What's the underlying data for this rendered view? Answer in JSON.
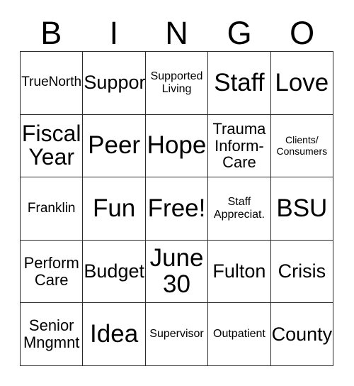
{
  "card": {
    "title": "BINGO",
    "header_letters": [
      "B",
      "I",
      "N",
      "G",
      "O"
    ],
    "border_color": "#2b2b2b",
    "cell_background": "#ffffff",
    "text_color": "#000000",
    "columns": 5,
    "rows": 5,
    "free_space_label": "Free!",
    "cells": [
      [
        {
          "text": "TrueNorth",
          "size": "sm"
        },
        {
          "text": "Support",
          "size": "lg"
        },
        {
          "text": "Supported\nLiving",
          "size": "xs"
        },
        {
          "text": "Staff",
          "size": "xxl"
        },
        {
          "text": "Love",
          "size": "xxl"
        }
      ],
      [
        {
          "text": "Fiscal\nYear",
          "size": "xl"
        },
        {
          "text": "Peer",
          "size": "xxl"
        },
        {
          "text": "Hope",
          "size": "xxl"
        },
        {
          "text": "Trauma\nInform-\nCare",
          "size": "md"
        },
        {
          "text": "Clients/\nConsumers",
          "size": "xxs"
        }
      ],
      [
        {
          "text": "Franklin",
          "size": "sm"
        },
        {
          "text": "Fun",
          "size": "xxl"
        },
        {
          "text": "Free!",
          "size": "xxl"
        },
        {
          "text": "Staff\nAppreciat.",
          "size": "xs"
        },
        {
          "text": "BSU",
          "size": "xxl"
        }
      ],
      [
        {
          "text": "Perform\nCare",
          "size": "md"
        },
        {
          "text": "Budget",
          "size": "lg"
        },
        {
          "text": "June\n30",
          "size": "xxl"
        },
        {
          "text": "Fulton",
          "size": "lg"
        },
        {
          "text": "Crisis",
          "size": "lg"
        }
      ],
      [
        {
          "text": "Senior\nMngmnt",
          "size": "md"
        },
        {
          "text": "Idea",
          "size": "xxl"
        },
        {
          "text": "Supervisor",
          "size": "xs"
        },
        {
          "text": "Outpatient",
          "size": "xs"
        },
        {
          "text": "County",
          "size": "lg"
        }
      ]
    ]
  }
}
